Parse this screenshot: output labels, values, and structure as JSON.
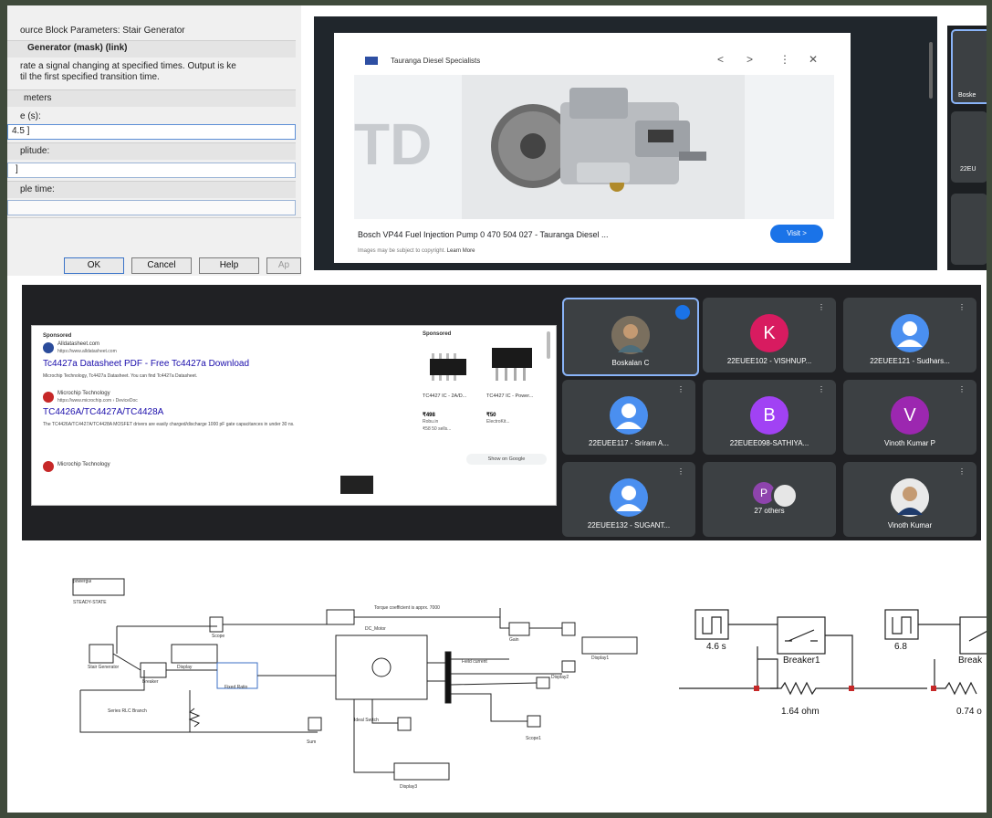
{
  "dialog": {
    "window_title": "ource Block Parameters: Stair Generator",
    "block_name": "Generator (mask) (link)",
    "desc_line1": "rate a signal changing at specified times. Output is ke",
    "desc_line2": "til the first specified transition time.",
    "section": "meters",
    "field1_label": "e (s):",
    "field1_value": "4.5 ]",
    "field2_label": "plitude:",
    "field2_value": "]",
    "field3_label": "ple time:",
    "buttons": {
      "ok": "OK",
      "cancel": "Cancel",
      "help": "Help",
      "apply": "Ap"
    }
  },
  "image_search": {
    "source": "Tauranga Diesel Specialists",
    "caption": "Bosch VP44 Fuel Injection Pump 0 470 504 027 - Tauranga Diesel ...",
    "visit": "Visit >",
    "note": "Images may be subject to copyright.",
    "learn": "Learn More",
    "nav": {
      "prev": "<",
      "next": ">",
      "more": "⋮",
      "close": "✕"
    },
    "right_strip_labels": [
      "Boske",
      "22EU"
    ]
  },
  "web_search": {
    "sponsored": "Sponsored",
    "ad_site": "Alldatasheet.com",
    "ad_url": "https://www.alldatasheet.com",
    "ad_title": "Tc4427a Datasheet PDF - Free Tc4427a Download",
    "ad_desc": "Microchip Technology, Tc4427a Datasheet. You can find Tc4427a Datasheet.",
    "r1_site": "Microchip Technology",
    "r1_url": "https://www.microchip.com › DeviceDoc",
    "r1_title": "TC4426A/TC4427A/TC4428A",
    "r1_desc": "The TC4426A/TC4427A/TC4428A MOSFET drivers are easily charged/discharge 1000 pF gate capacitances in under 30 ns.",
    "r2_site": "Microchip Technology",
    "shop_head": "Sponsored",
    "products": [
      {
        "title": "TC4427 IC - 2A/D...",
        "price": "₹498",
        "store": "Robu.in",
        "extra": "₹58 50 sells..."
      },
      {
        "title": "TC4427 IC - Power...",
        "price": "₹50",
        "store": "ElectroKit..."
      }
    ],
    "show_more": "Show on Google"
  },
  "meet": {
    "participants": [
      {
        "name": "Boskalan C",
        "initial": "",
        "color": "#6b6f73",
        "kind": "photo"
      },
      {
        "name": "22EUEE102 - VISHNUP...",
        "initial": "K",
        "color": "#d81b60",
        "kind": "letter"
      },
      {
        "name": "22EUEE121 - Sudhars...",
        "initial": "",
        "color": "#4a8ff0",
        "kind": "default"
      },
      {
        "name": "22EUEE117 - Sriram A...",
        "initial": "",
        "color": "#4a8ff0",
        "kind": "default"
      },
      {
        "name": "22EUEE098-SATHIYA...",
        "initial": "B",
        "color": "#a142f4",
        "kind": "letter"
      },
      {
        "name": "Vinoth Kumar P",
        "initial": "V",
        "color": "#9c27b0",
        "kind": "letter"
      },
      {
        "name": "22EUEE132 - SUGANT...",
        "initial": "",
        "color": "#4a8ff0",
        "kind": "default"
      },
      {
        "name": "27 others",
        "initial": "P",
        "color": "#8e44ad",
        "kind": "others"
      },
      {
        "name": "Vinoth Kumar",
        "initial": "",
        "color": "#d0d0d0",
        "kind": "photo2"
      }
    ]
  },
  "simulink_left": {
    "labels": [
      "powergui",
      "STEADY-STATE",
      "Stair Generator",
      "Breaker",
      "Scope",
      "Display",
      "DC_Motor",
      "Fixed Ratio",
      "Series RLC Branch",
      "Torque coefficient is apprx. 7000",
      "Gain",
      "Display1",
      "Display2",
      "Display3",
      "Scope1",
      "Sum",
      "Field current",
      "Ideal Switch"
    ]
  },
  "simulink_right": {
    "step1": "4.6 s",
    "step2": "6.8",
    "breaker1": "Breaker1",
    "breaker2": "Break",
    "r1": "1.64 ohm",
    "r2": "0.74 o"
  }
}
